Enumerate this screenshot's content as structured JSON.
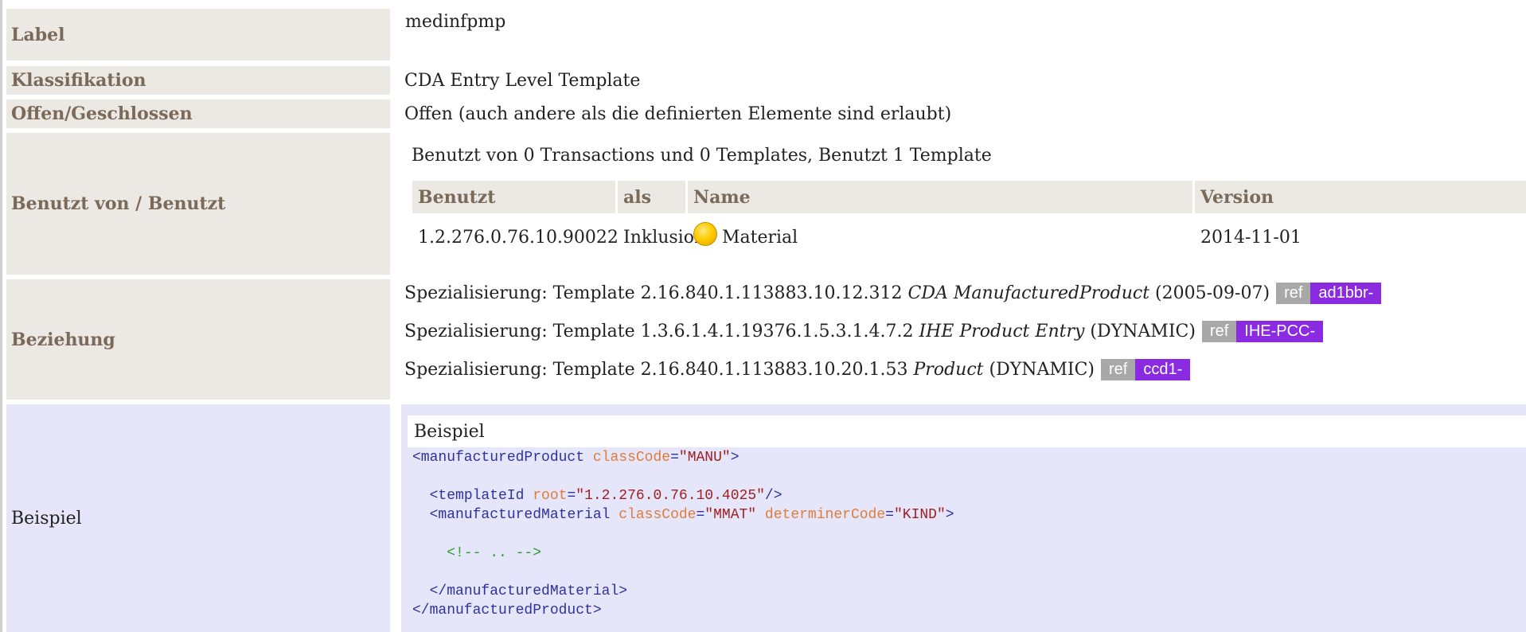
{
  "rows": {
    "label": {
      "key": "Label",
      "value": "medinfpmp"
    },
    "klassifikation": {
      "key": "Klassifikation",
      "value": "CDA Entry Level Template"
    },
    "offen": {
      "key": "Offen/Geschlossen",
      "value": "Offen (auch andere als die definierten Elemente sind erlaubt)"
    },
    "benutzt": {
      "key": "Benutzt von / Benutzt",
      "summary": "Benutzt von 0 Transactions und 0 Templates, Benutzt 1 Template",
      "headers": [
        "Benutzt",
        "als",
        "Name",
        "Version"
      ],
      "row": {
        "id": "1.2.276.0.76.10.90022",
        "als": "Inklusion",
        "name": "Material",
        "version": "2014-11-01"
      }
    },
    "beziehung": {
      "key": "Beziehung",
      "items": [
        {
          "prefix": "Spezialisierung: Template 2.16.840.1.113883.10.12.312",
          "name": "CDA ManufacturedProduct",
          "suffix": "(2005-09-07)",
          "ref": "ref",
          "refid": "ad1bbr-"
        },
        {
          "prefix": "Spezialisierung: Template 1.3.6.1.4.1.19376.1.5.3.1.4.7.2",
          "name": "IHE Product Entry",
          "suffix": "(DYNAMIC)",
          "ref": "ref",
          "refid": "IHE-PCC-"
        },
        {
          "prefix": "Spezialisierung: Template 2.16.840.1.113883.10.20.1.53",
          "name": "Product",
          "suffix": "(DYNAMIC)",
          "ref": "ref",
          "refid": "ccd1-"
        }
      ]
    },
    "beispiel": {
      "key": "Beispiel",
      "title": "Beispiel",
      "code": {
        "l1_tag": "<manufacturedProduct",
        "l1_attr": "classCode",
        "l1_val": "\"MANU\"",
        "l1_end": ">",
        "l2_tag": "<templateId",
        "l2_attr": "root",
        "l2_val": "\"1.2.276.0.76.10.4025\"",
        "l2_end": "/>",
        "l3_tag": "<manufacturedMaterial",
        "l3_attr1": "classCode",
        "l3_val1": "\"MMAT\"",
        "l3_attr2": "determinerCode",
        "l3_val2": "\"KIND\"",
        "l3_end": ">",
        "comment": "<!-- .. -->",
        "close1": "</manufacturedMaterial>",
        "close2": "</manufacturedProduct>"
      }
    }
  },
  "colors": {
    "label_bg": "#ece8e3",
    "label_fg": "#7a6a5a",
    "example_bg": "#e6e6fa",
    "refid_bg": "#8a2be2",
    "ref_bg": "#a8a8a8"
  }
}
